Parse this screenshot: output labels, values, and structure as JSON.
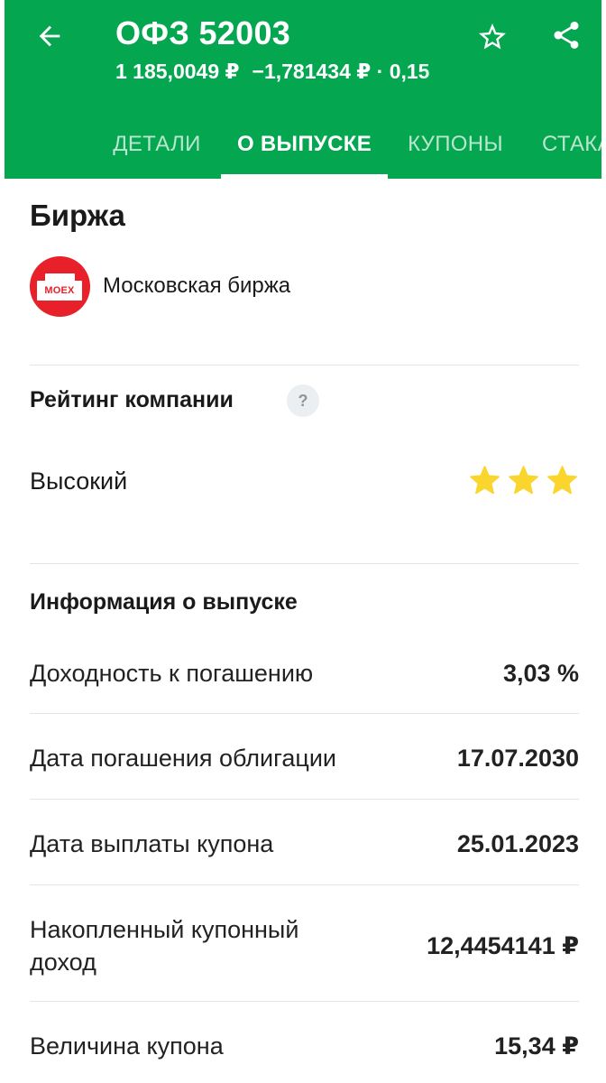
{
  "header": {
    "title": "ОФЗ 52003",
    "price": "1 185,0049 ₽",
    "change": "−1,781434 ₽ · 0,15",
    "icons": {
      "back": "arrow-back-icon",
      "favorite": "star-outline-icon",
      "share": "share-icon"
    }
  },
  "tabs": [
    {
      "label": "ДЕТАЛИ",
      "active": false
    },
    {
      "label": "О ВЫПУСКЕ",
      "active": true
    },
    {
      "label": "КУПОНЫ",
      "active": false
    },
    {
      "label": "СТАКАН",
      "active": false
    }
  ],
  "exchange": {
    "heading": "Биржа",
    "logo_text": "MOEX",
    "name": "Московская биржа"
  },
  "rating": {
    "heading": "Рейтинг компании",
    "help_label": "?",
    "level": "Высокий",
    "stars": 3,
    "stars_max": 3,
    "star_color": "#fad52e"
  },
  "issue_info": {
    "heading": "Информация о выпуске",
    "rows": [
      {
        "label": "Доходность к погашению",
        "value": "3,03 %"
      },
      {
        "label": "Дата погашения облигации",
        "value": "17.07.2030"
      },
      {
        "label": "Дата выплаты купона",
        "value": "25.01.2023"
      },
      {
        "label": "Накопленный купонный доход",
        "value": "12,4454141 ₽"
      },
      {
        "label": "Величина купона",
        "value": "15,34 ₽"
      }
    ]
  },
  "colors": {
    "brand": "#04a650",
    "text": "#1a1a1a",
    "divider": "#e4e4e4",
    "moex_red": "#e7202a"
  }
}
